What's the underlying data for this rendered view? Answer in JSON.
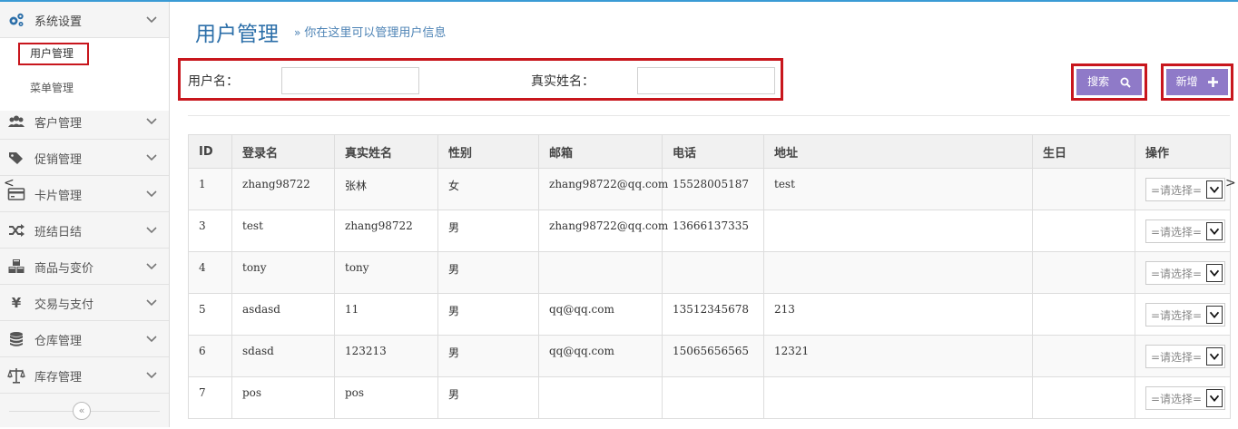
{
  "sidebar": {
    "items": [
      {
        "label": "系统设置",
        "icon": "gears-icon"
      },
      {
        "label": "客户管理",
        "icon": "users-icon"
      },
      {
        "label": "促销管理",
        "icon": "tags-icon"
      },
      {
        "label": "卡片管理",
        "icon": "credit-card-icon"
      },
      {
        "label": "班结日结",
        "icon": "shuffle-icon"
      },
      {
        "label": "商品与变价",
        "icon": "cubes-icon"
      },
      {
        "label": "交易与支付",
        "icon": "yen-icon"
      },
      {
        "label": "仓库管理",
        "icon": "database-icon"
      },
      {
        "label": "库存管理",
        "icon": "balance-scale-icon"
      }
    ],
    "sub_items": [
      {
        "label": "用户管理",
        "selected": true
      },
      {
        "label": "菜单管理",
        "selected": false
      }
    ],
    "collapse_glyph": "«"
  },
  "header": {
    "title": "用户管理",
    "desc_arrow": "»",
    "description": "你在这里可以管理用户信息"
  },
  "search": {
    "username_label": "用户名：",
    "realname_label": "真实姓名：",
    "username_value": "",
    "realname_value": ""
  },
  "buttons": {
    "search_label": "搜索",
    "add_label": "新增",
    "accent_color": "#8f7ac8"
  },
  "table": {
    "columns": [
      "ID",
      "登录名",
      "真实姓名",
      "性别",
      "邮箱",
      "电话",
      "地址",
      "生日",
      "操作"
    ],
    "select_placeholder": "=请选择=",
    "rows": [
      {
        "id": "1",
        "login": "zhang98722",
        "real_name": "张林",
        "gender": "女",
        "email": "zhang98722@qq.com",
        "phone": "15528005187",
        "address": "test",
        "birthday": ""
      },
      {
        "id": "3",
        "login": "test",
        "real_name": "zhang98722",
        "gender": "男",
        "email": "zhang98722@qq.com",
        "phone": "13666137335",
        "address": "",
        "birthday": ""
      },
      {
        "id": "4",
        "login": "tony",
        "real_name": "tony",
        "gender": "男",
        "email": "",
        "phone": "",
        "address": "",
        "birthday": ""
      },
      {
        "id": "5",
        "login": "asdasd",
        "real_name": "11",
        "gender": "男",
        "email": "qq@qq.com",
        "phone": "13512345678",
        "address": "213",
        "birthday": ""
      },
      {
        "id": "6",
        "login": "sdasd",
        "real_name": "123213",
        "gender": "男",
        "email": "qq@qq.com",
        "phone": "15065656565",
        "address": "12321",
        "birthday": ""
      },
      {
        "id": "7",
        "login": "pos",
        "real_name": "pos",
        "gender": "男",
        "email": "",
        "phone": "",
        "address": "",
        "birthday": ""
      }
    ]
  },
  "scroll": {
    "left": "<",
    "right": ">"
  }
}
